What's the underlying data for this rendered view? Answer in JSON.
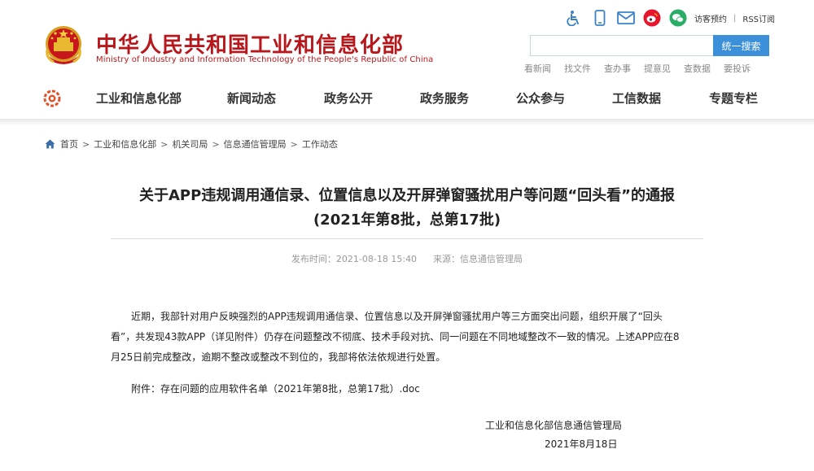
{
  "header": {
    "title": "中华人民共和国工业和信息化部",
    "subtitle": "Ministry of Industry and Information Technology of the People's Republic of China",
    "top_links": {
      "visitor": "访客预约",
      "rss": "RSS订阅"
    },
    "top_icons": [
      "accessibility-icon",
      "mobile-icon",
      "mail-icon",
      "weibo-icon",
      "wechat-icon"
    ],
    "search": {
      "value": "",
      "button": "统一搜索"
    },
    "quick_links": [
      "看新闻",
      "找文件",
      "查办事",
      "提意见",
      "查数据",
      "要投诉"
    ]
  },
  "nav": {
    "items": [
      "工业和信息化部",
      "新闻动态",
      "政务公开",
      "政务服务",
      "公众参与",
      "工信数据",
      "专题专栏"
    ]
  },
  "breadcrumb": {
    "items": [
      "首页",
      "工业和信息化部",
      "机关司局",
      "信息通信管理局",
      "工作动态"
    ],
    "separator": ">"
  },
  "article": {
    "title_line1": "关于APP违规调用通信录、位置信息以及开屏弹窗骚扰用户等问题“回头看”的通报",
    "title_line2": "(2021年第8批，总第17批)",
    "publish_time": "发布时间：2021-08-18 15:40",
    "source": "来源：信息通信管理局",
    "body_line1": "近期，我部针对用户反映强烈的APP违规调用通信录、位置信息以及开屏弹窗骚扰用户等三方面突出问题，组织开展了“回头",
    "body_line2": "看”，共发现43款APP（详见附件）仍存在问题整改不彻底、技术手段对抗、同一问题在不同地域整改不一致的情况。上述APP应在8",
    "body_line3": "月25日前完成整改，逾期不整改或整改不到位的，我部将依法依规进行处置。",
    "attachment": "附件：存在问题的应用软件名单（2021年第8批，总第17批）.doc",
    "signature_org": "工业和信息化部信息通信管理局",
    "signature_date": "2021年8月18日"
  },
  "colors": {
    "brand_red": "#b8181c",
    "search_blue": "#3c8fd9",
    "weibo_red": "#e6162d",
    "wechat_green": "#2aae67",
    "icon_blue": "#3a82c8"
  }
}
